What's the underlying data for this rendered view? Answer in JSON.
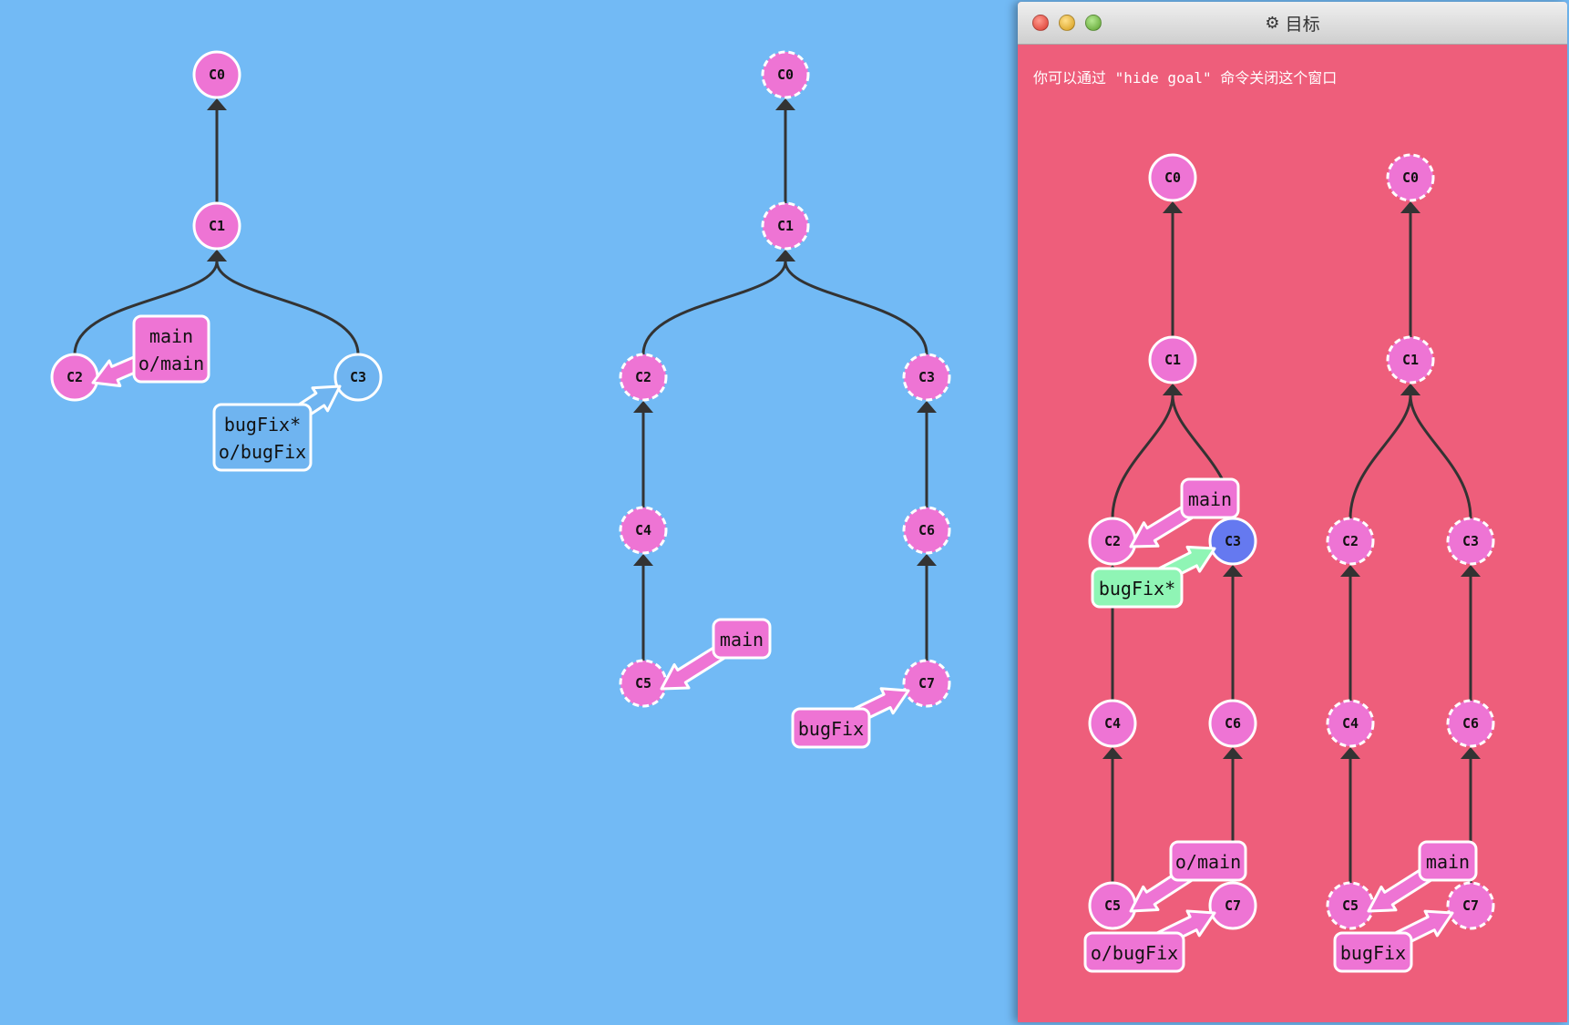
{
  "goal_window": {
    "title": "目标",
    "title_icon": "gear-icon",
    "hint": "你可以通过 \"hide goal\" 命令关闭这个窗口"
  },
  "colors": {
    "background": "#72baf5",
    "goal_background": "#ee5e7b",
    "commit": "#ee74d4",
    "commit_local_checked_out": "#6fb4f0",
    "commit_goal_checked_out": "#6579f0",
    "branch_local_head": "#6fb4f0",
    "branch_goal_head": "#8ff5b5",
    "edge": "#333333"
  },
  "current_local": {
    "commits": [
      "C0",
      "C1",
      "C2",
      "C3"
    ],
    "checked_out_commit": "C3",
    "branches": [
      {
        "lines": [
          "main",
          "o/main"
        ],
        "target": "C2"
      },
      {
        "lines": [
          "bugFix*",
          "o/bugFix"
        ],
        "target": "C3",
        "head": true
      }
    ]
  },
  "current_remote": {
    "commits": [
      "C0",
      "C1",
      "C2",
      "C3",
      "C4",
      "C5",
      "C6",
      "C7"
    ],
    "branches": [
      {
        "lines": [
          "main"
        ],
        "target": "C5"
      },
      {
        "lines": [
          "bugFix"
        ],
        "target": "C7"
      }
    ]
  },
  "goal_local": {
    "commits": [
      "C0",
      "C1",
      "C2",
      "C3",
      "C4",
      "C5",
      "C6",
      "C7"
    ],
    "checked_out_commit": "C3",
    "branches": [
      {
        "lines": [
          "main"
        ],
        "target": "C2"
      },
      {
        "lines": [
          "bugFix*"
        ],
        "target": "C3",
        "head": true
      },
      {
        "lines": [
          "o/main"
        ],
        "target": "C5"
      },
      {
        "lines": [
          "o/bugFix"
        ],
        "target": "C7"
      }
    ]
  },
  "goal_remote": {
    "commits": [
      "C0",
      "C1",
      "C2",
      "C3",
      "C4",
      "C5",
      "C6",
      "C7"
    ],
    "branches": [
      {
        "lines": [
          "main"
        ],
        "target": "C5"
      },
      {
        "lines": [
          "bugFix"
        ],
        "target": "C7"
      }
    ]
  }
}
